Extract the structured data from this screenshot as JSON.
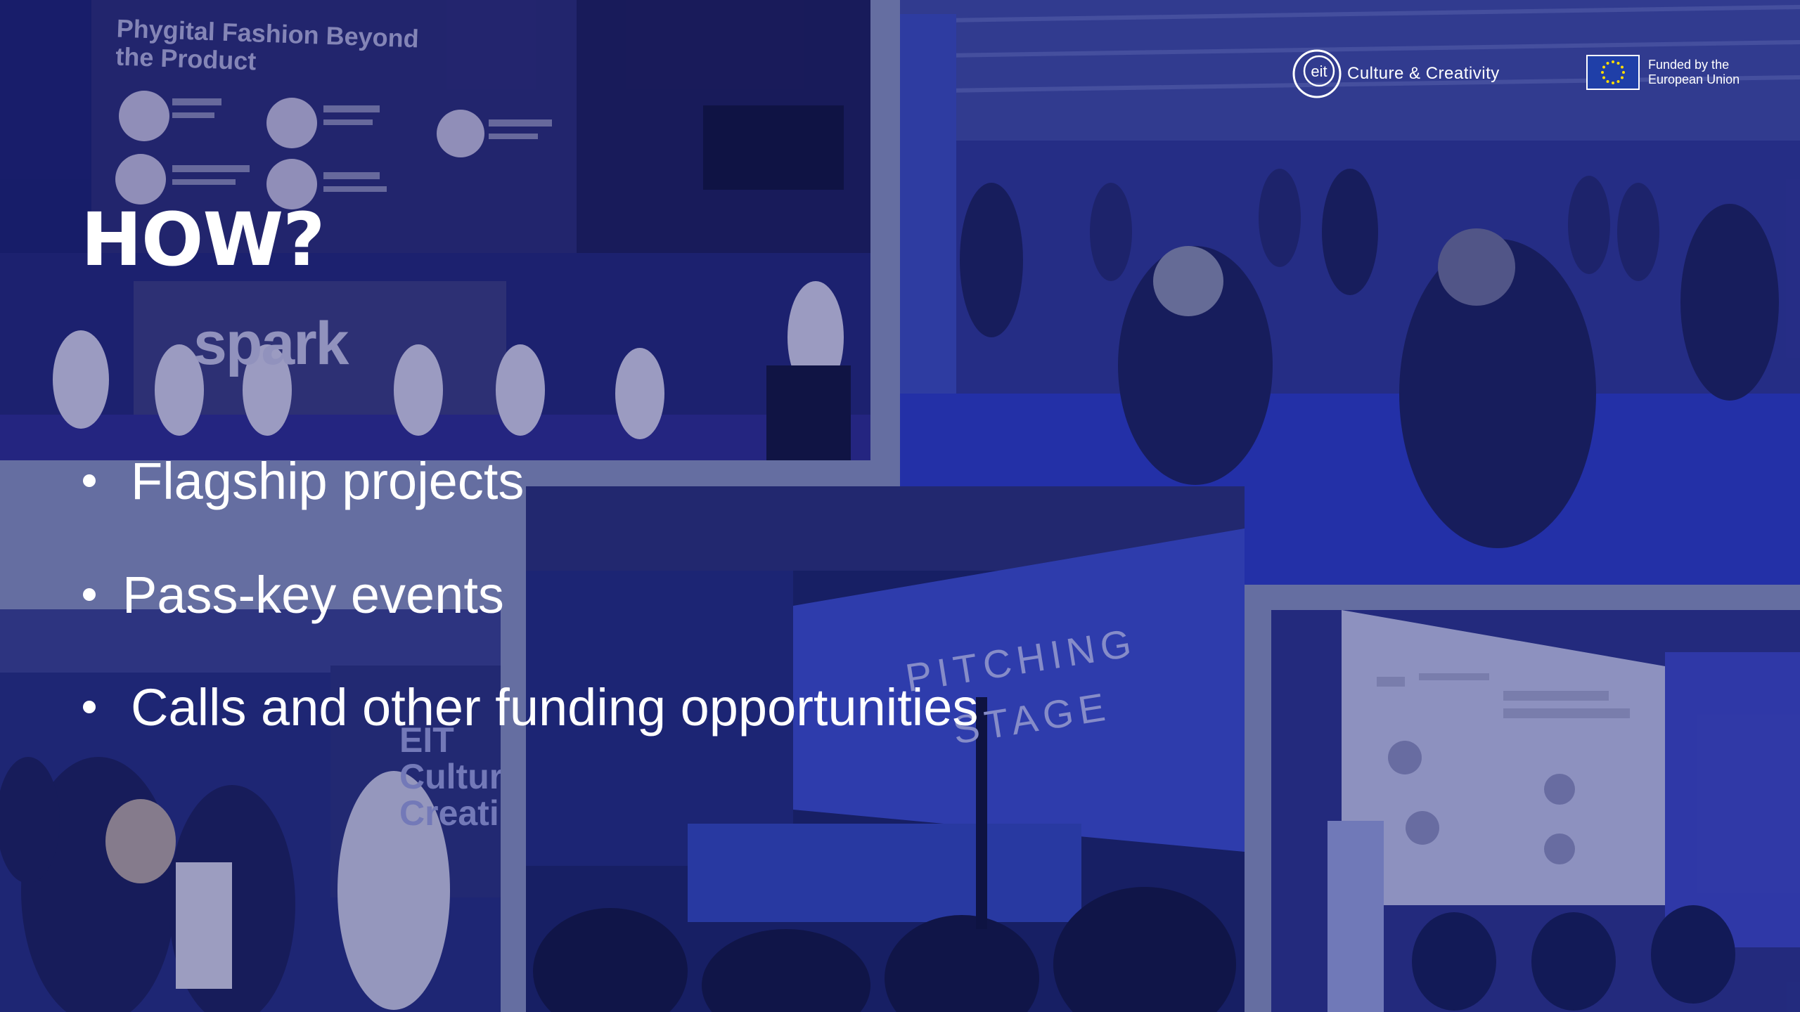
{
  "slide": {
    "title": "HOW?",
    "bullets": [
      "Flagship projects",
      "Pass-key events",
      "Calls and other funding opportunities"
    ]
  },
  "photos": {
    "top_left": {
      "sign_title_line1": "Phygital Fashion Beyond",
      "sign_title_line2": "the Product",
      "stage_sign": "spark"
    },
    "center": {
      "stage_sign_line1": "PITCHING",
      "stage_sign_line2": "STAGE"
    },
    "bottom_left": {
      "banner_line1": "EIT",
      "banner_line2": "Cultur",
      "banner_line3": "Creati"
    }
  },
  "logos": {
    "eit_mark": "eit",
    "eit_text": "Culture & Creativity",
    "eu_line1": "Funded by the",
    "eu_line2": "European Union",
    "eu_flag_icon": "eu-flag-icon"
  },
  "colors": {
    "overlay": "#1a2a8c",
    "text": "#ffffff",
    "frame": "#8a93b8"
  }
}
